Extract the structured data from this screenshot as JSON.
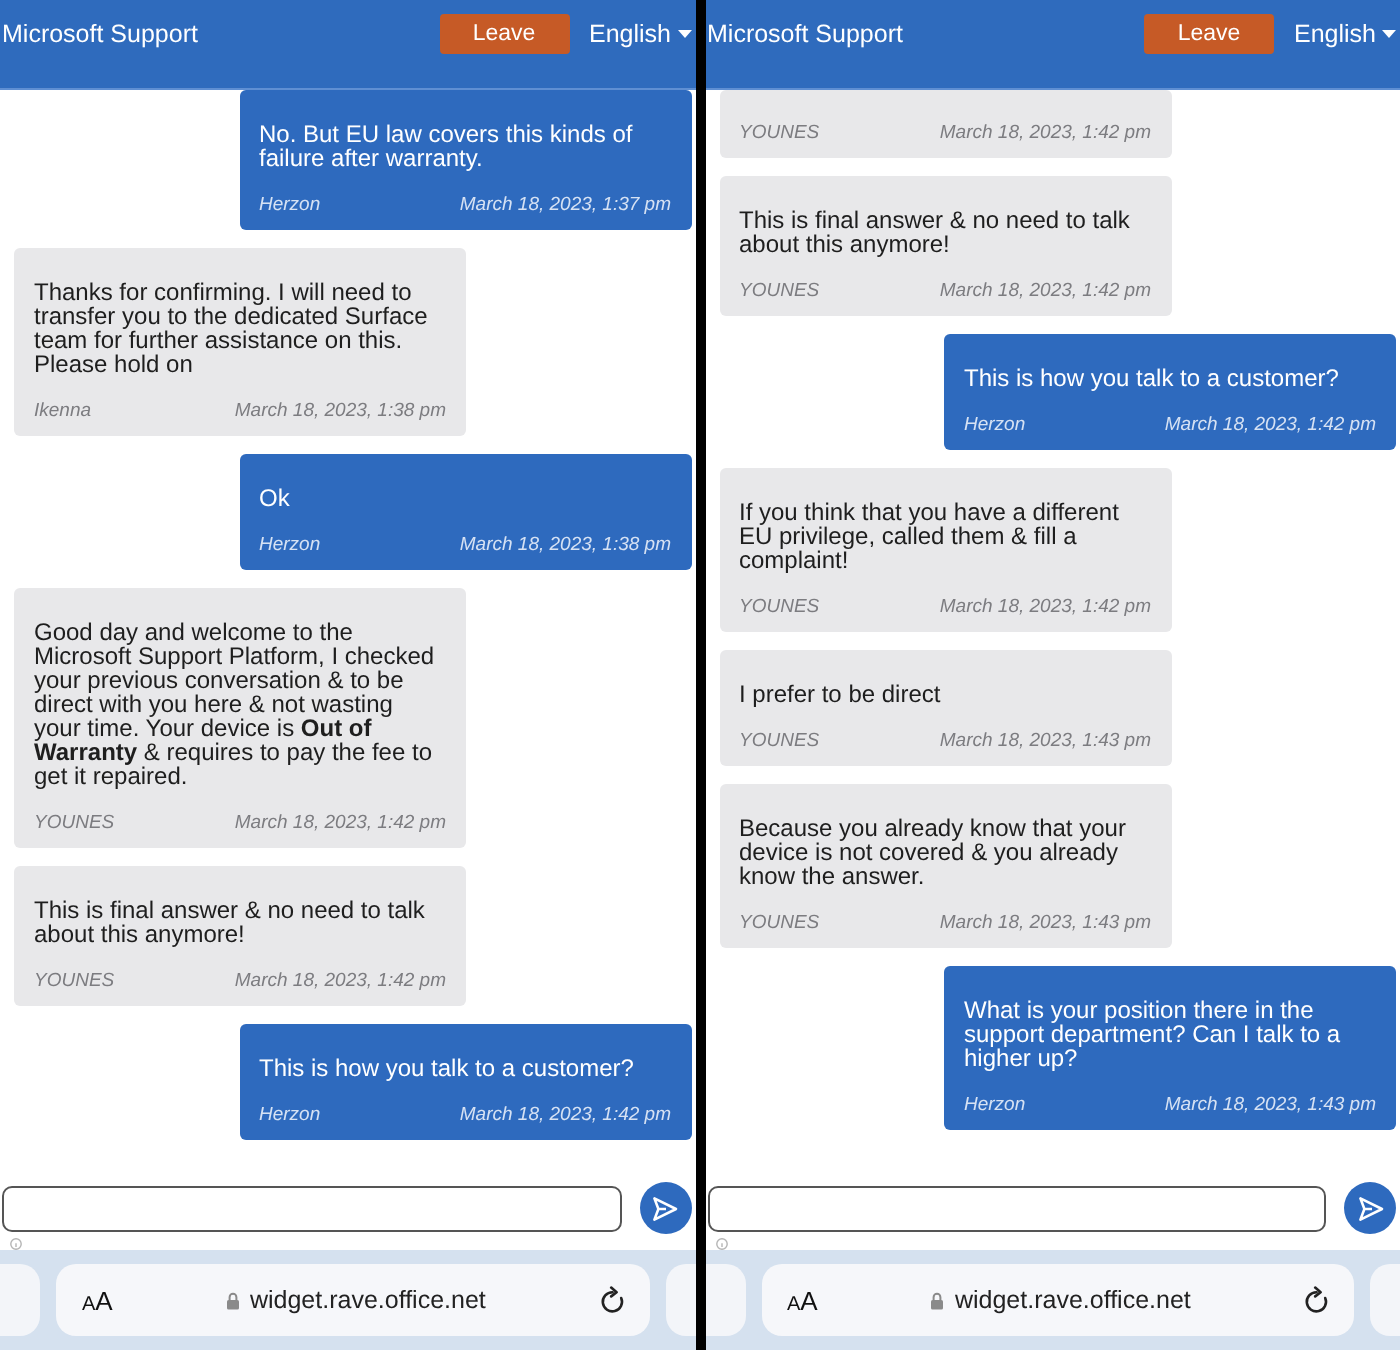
{
  "panels": [
    {
      "header": {
        "title": "Microsoft Support",
        "leave_button": "Leave",
        "language": "English"
      },
      "messages": [
        {
          "kind": "sent",
          "text": "No. But EU law covers this kinds of failure after warranty.",
          "sender": "Herzon",
          "time": "March 18, 2023, 1:37 pm"
        },
        {
          "kind": "received",
          "text": "Thanks for confirming. I will need to transfer you to the dedicated Surface team for further assistance on this. Please hold on",
          "sender": "Ikenna",
          "time": "March 18, 2023, 1:38 pm"
        },
        {
          "kind": "sent",
          "text": "Ok",
          "sender": "Herzon",
          "time": "March 18, 2023, 1:38 pm"
        },
        {
          "kind": "received",
          "text": "Good day and welcome to the Microsoft Support Platform, I checked your previous conversation & to be direct with you here & not wasting your time. Your device is **Out of Warranty** & requires to pay the fee to get it repaired.",
          "sender": "YOUNES",
          "time": "March 18, 2023, 1:42 pm"
        },
        {
          "kind": "received",
          "text": "This is final answer & no need to talk about this anymore!",
          "sender": "YOUNES",
          "time": "March 18, 2023, 1:42 pm"
        },
        {
          "kind": "sent",
          "text": "This is how you talk to a customer?",
          "sender": "Herzon",
          "time": "March 18, 2023, 1:42 pm"
        }
      ],
      "browser_bar": {
        "text_size_button": "AA",
        "url": "widget.rave.office.net"
      }
    },
    {
      "header": {
        "title": "Microsoft Support",
        "leave_button": "Leave",
        "language": "English"
      },
      "messages": [
        {
          "kind": "received",
          "sender": "YOUNES",
          "time": "March 18, 2023, 1:42 pm"
        },
        {
          "kind": "received",
          "text": "This is final answer & no need to talk about this anymore!",
          "sender": "YOUNES",
          "time": "March 18, 2023, 1:42 pm"
        },
        {
          "kind": "sent",
          "text": "This is how you talk to a customer?",
          "sender": "Herzon",
          "time": "March 18, 2023, 1:42 pm"
        },
        {
          "kind": "received",
          "text": "If you think that you have a different EU privilege, called them & fill a complaint!",
          "sender": "YOUNES",
          "time": "March 18, 2023, 1:42 pm"
        },
        {
          "kind": "received",
          "text": "I prefer to be direct",
          "sender": "YOUNES",
          "time": "March 18, 2023, 1:43 pm"
        },
        {
          "kind": "received",
          "text": "Because you already know that your device is not covered & you already know the answer.",
          "sender": "YOUNES",
          "time": "March 18, 2023, 1:43 pm"
        },
        {
          "kind": "sent",
          "text": "What is your position there in the support department? Can I talk to a higher up?",
          "sender": "Herzon",
          "time": "March 18, 2023, 1:43 pm"
        }
      ],
      "browser_bar": {
        "text_size_button": "AA",
        "url": "widget.rave.office.net"
      }
    }
  ]
}
